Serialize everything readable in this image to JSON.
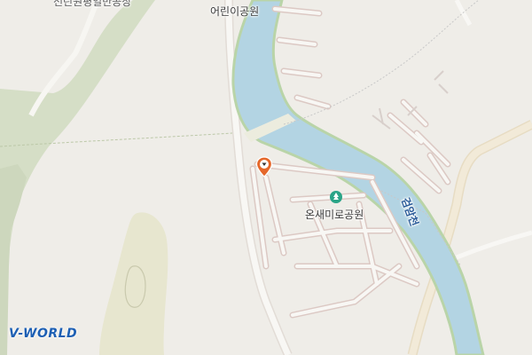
{
  "map": {
    "labels": {
      "top_left_partial": "선린원평일반공장",
      "childrens_park": "어린이공원",
      "onsaemiro_park": "온새미로공원",
      "stream": "검암천"
    },
    "icons": {
      "park_poi": "park-icon",
      "location_pin": "map-pin-icon"
    },
    "colors": {
      "background": "#efede8",
      "water": "#b3d4e3",
      "green": "#d6dfc8",
      "road_edge": "#d9c6c2",
      "major_road": "#ede1c9",
      "pin": "#e5672a",
      "brand": "#1d5fb3"
    },
    "logo": "V-WORLD"
  }
}
